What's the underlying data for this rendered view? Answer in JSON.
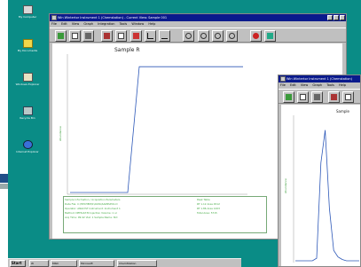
{
  "desktop": {
    "icons": [
      {
        "name": "my-computer",
        "label": "My Computer"
      },
      {
        "name": "my-documents",
        "label": "My Documents"
      },
      {
        "name": "windows-explorer",
        "label": "Windows Explorer"
      },
      {
        "name": "recycle-bin",
        "label": "Recycle Bin"
      },
      {
        "name": "internet-explorer",
        "label": "Internet Explorer"
      }
    ]
  },
  "taskbar": {
    "start": "Start",
    "items": [
      "W",
      "MSD",
      "Microsoft",
      "ChemStation"
    ]
  },
  "window1": {
    "title": "Win Wintertor Instrument 1 (Chemstation) - Current View: Sample 001",
    "menus": [
      "File",
      "Edit",
      "View",
      "Graph",
      "Integration",
      "Tools",
      "Window",
      "Help"
    ],
    "chart_title": "Sample R",
    "ylabel": "Abundance",
    "report_lines": [
      "Sample Information / Acquisition Parameters",
      "Data File: C:\\HPCHEM\\1\\DATA\\SAMPLE01.D",
      "Operator: ANALYST   Instrument: Instrument 1",
      "Method: DEFAULT.M   Injection Volume: 1 ul",
      "Acq Time: 09:42   Vial: 1   Sample Name: Std"
    ],
    "report_right": [
      "Peak Table",
      "RT 1.12  Area 4512",
      "RT 1.86  Area 1203",
      "Total Area: 5715"
    ]
  },
  "window2": {
    "title": "Win Wintertor Instrument 1 (Chemstation)",
    "menus": [
      "File",
      "Edit",
      "View",
      "Graph",
      "Tools",
      "Help"
    ],
    "chart_title": "Sample",
    "ylabel": "Abundance"
  },
  "chart_data": [
    {
      "type": "line",
      "title": "Sample R",
      "series": [
        {
          "values": [
            0,
            0,
            0,
            0,
            0,
            0,
            100,
            100,
            100,
            100,
            100,
            100,
            100,
            100,
            100,
            100
          ]
        }
      ],
      "ylim": [
        0,
        110
      ]
    },
    {
      "type": "line",
      "title": "Sample",
      "series": [
        {
          "values": [
            0,
            0,
            0,
            0,
            0,
            2,
            75,
            100,
            40,
            8,
            3,
            1,
            0,
            0,
            0,
            0
          ]
        }
      ],
      "ylim": [
        0,
        110
      ]
    }
  ]
}
